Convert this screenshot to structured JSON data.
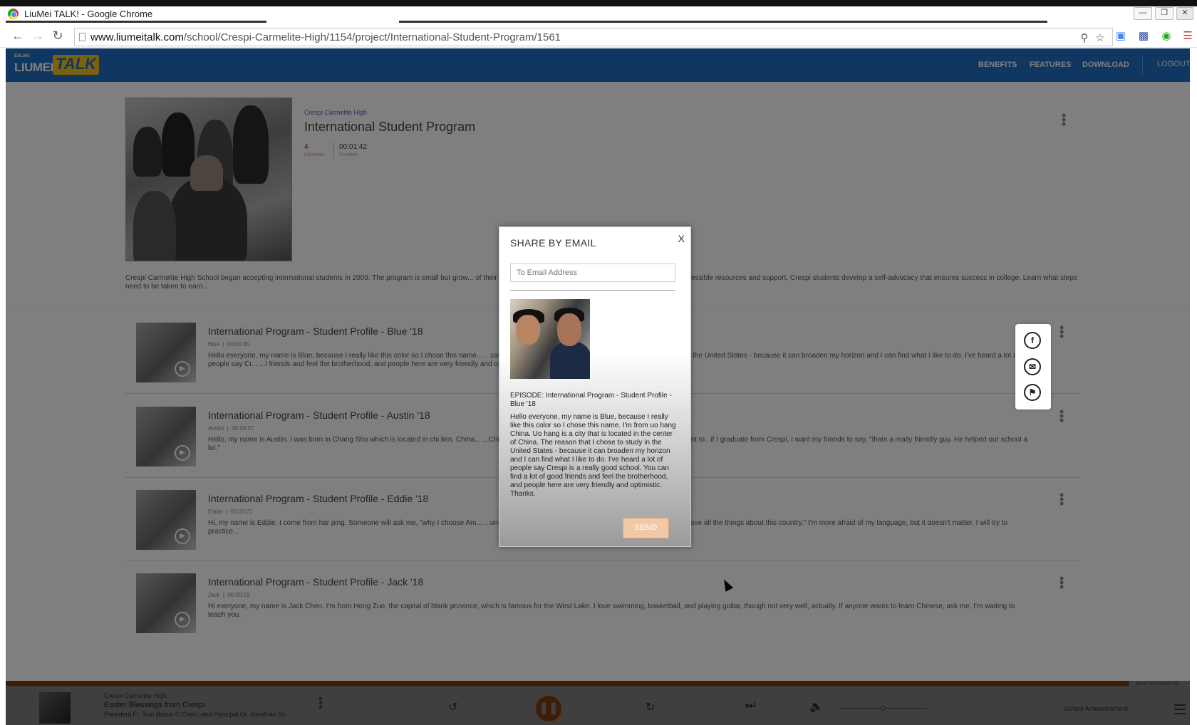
{
  "browser": {
    "title": "LiuMei TALK! - Google Chrome",
    "url_domain": "www.liumeitalk.com",
    "url_path": "/school/Crespi-Carmelite-High/1154/project/International-Student-Program/1561"
  },
  "nav": {
    "logo_small": "ESL365",
    "logo_left": "LIUMEI",
    "logo_right": "TALK",
    "links": [
      "BENEFITS",
      "FEATURES",
      "DOWNLOAD"
    ],
    "logout": "LOGOUT"
  },
  "project": {
    "school": "Crespi Carmelite High",
    "title": "International Student Program",
    "episodes_count": "4",
    "episodes_label": "Episodes",
    "duration": "00:01:42",
    "duration_label": "Duration",
    "description": "Crespi Carmelite High School began accepting international students in 2009. The program is small but grow... of their education by encouraging their intellectual curiosity. With accessible resources and support, Crespi students develop a self-advocacy that ensures success in college. Learn what steps need to be taken to earn..."
  },
  "episodes": [
    {
      "title": "International Program - Student Profile - Blue '18",
      "speaker": "Blue",
      "duration": "00:00:35",
      "desc": "Hello everyone, my name is Blue, because I really like this color so I chose this name...                    ...cated in the center of China.  The reason that I chose to study in the United States - because it can broaden my horizon and I can find what I like to do.  I've heard a lot of people say Cr...                    ...l friends and feel the brotherhood, and people here are very friendly and optimistic.  Thanks."
    },
    {
      "title": "International Program - Student Profile - Austin '18",
      "speaker": "Austin",
      "duration": "00:00:27",
      "desc": "Hello, my name is Austin.  I was born in Chang Sho which is located in chi lien. China...                    ...Chinese students, because my English is not good enough.  I want to...if I graduate from Crespi, I want my friends to say, \"thats a really friendly guy.  He helped our school a lot.\""
    },
    {
      "title": "International Program - Student Profile - Eddie '18",
      "speaker": "Eddie",
      "duration": "00:00:21",
      "desc": "Hi, my name is Eddie.  I come from har ping.  Someone will ask me, \"why I choose Am...                    ...untry, love tihs country's education, love this country's people - love all the things about this country.\"  I'm more afraid of my language, but it doesn't matter.  I will try to practice..."
    },
    {
      "title": "International Program - Student Profile - Jack '18",
      "speaker": "Jack",
      "duration": "00:00:19",
      "desc": "Hi everyone, my name is Jack Chen.  I'm from Hong Zuo, the capital of blank province, which is famous for the West Lake.  I love swimming, basketball, and playing guitar, though not very well, actually.  If anyone wants to learn Chinese, ask me, I'm waiting to teach you."
    }
  ],
  "share_panel": {
    "facebook": "f",
    "email": "✉",
    "flag": "⚑"
  },
  "modal": {
    "title": "SHARE BY EMAIL",
    "close": "X",
    "email_placeholder": "To Email Address",
    "episode_line": "EPISODE: International Program - Student Profile - Blue '18",
    "body": "Hello everyone, my name is Blue, because I really like this color so I chose this name.  I'm from uo hang China.  Uo hang is a city that is located in the center of China.  The reason that I chose to study in the United States - because it can broaden my horizon and I can find what I like to do.  I've heard a lot of people say Crespi is a really good school.  You can find a lot of good friends and feel the brotherhood, and people here are very friendly and optimistic.  Thanks.",
    "send": "SEND"
  },
  "player": {
    "time": "00:01:25 / 00:01:29",
    "progress": 0.997,
    "school": "Crespi Carmelite High",
    "title": "Easter Blessings from Crespi",
    "subtitle": "President Fr. Tom Batsis O.Carm. and Principal Dr. Jonathan Sc...",
    "next_label": "School Announcement",
    "volume": 0.47
  }
}
